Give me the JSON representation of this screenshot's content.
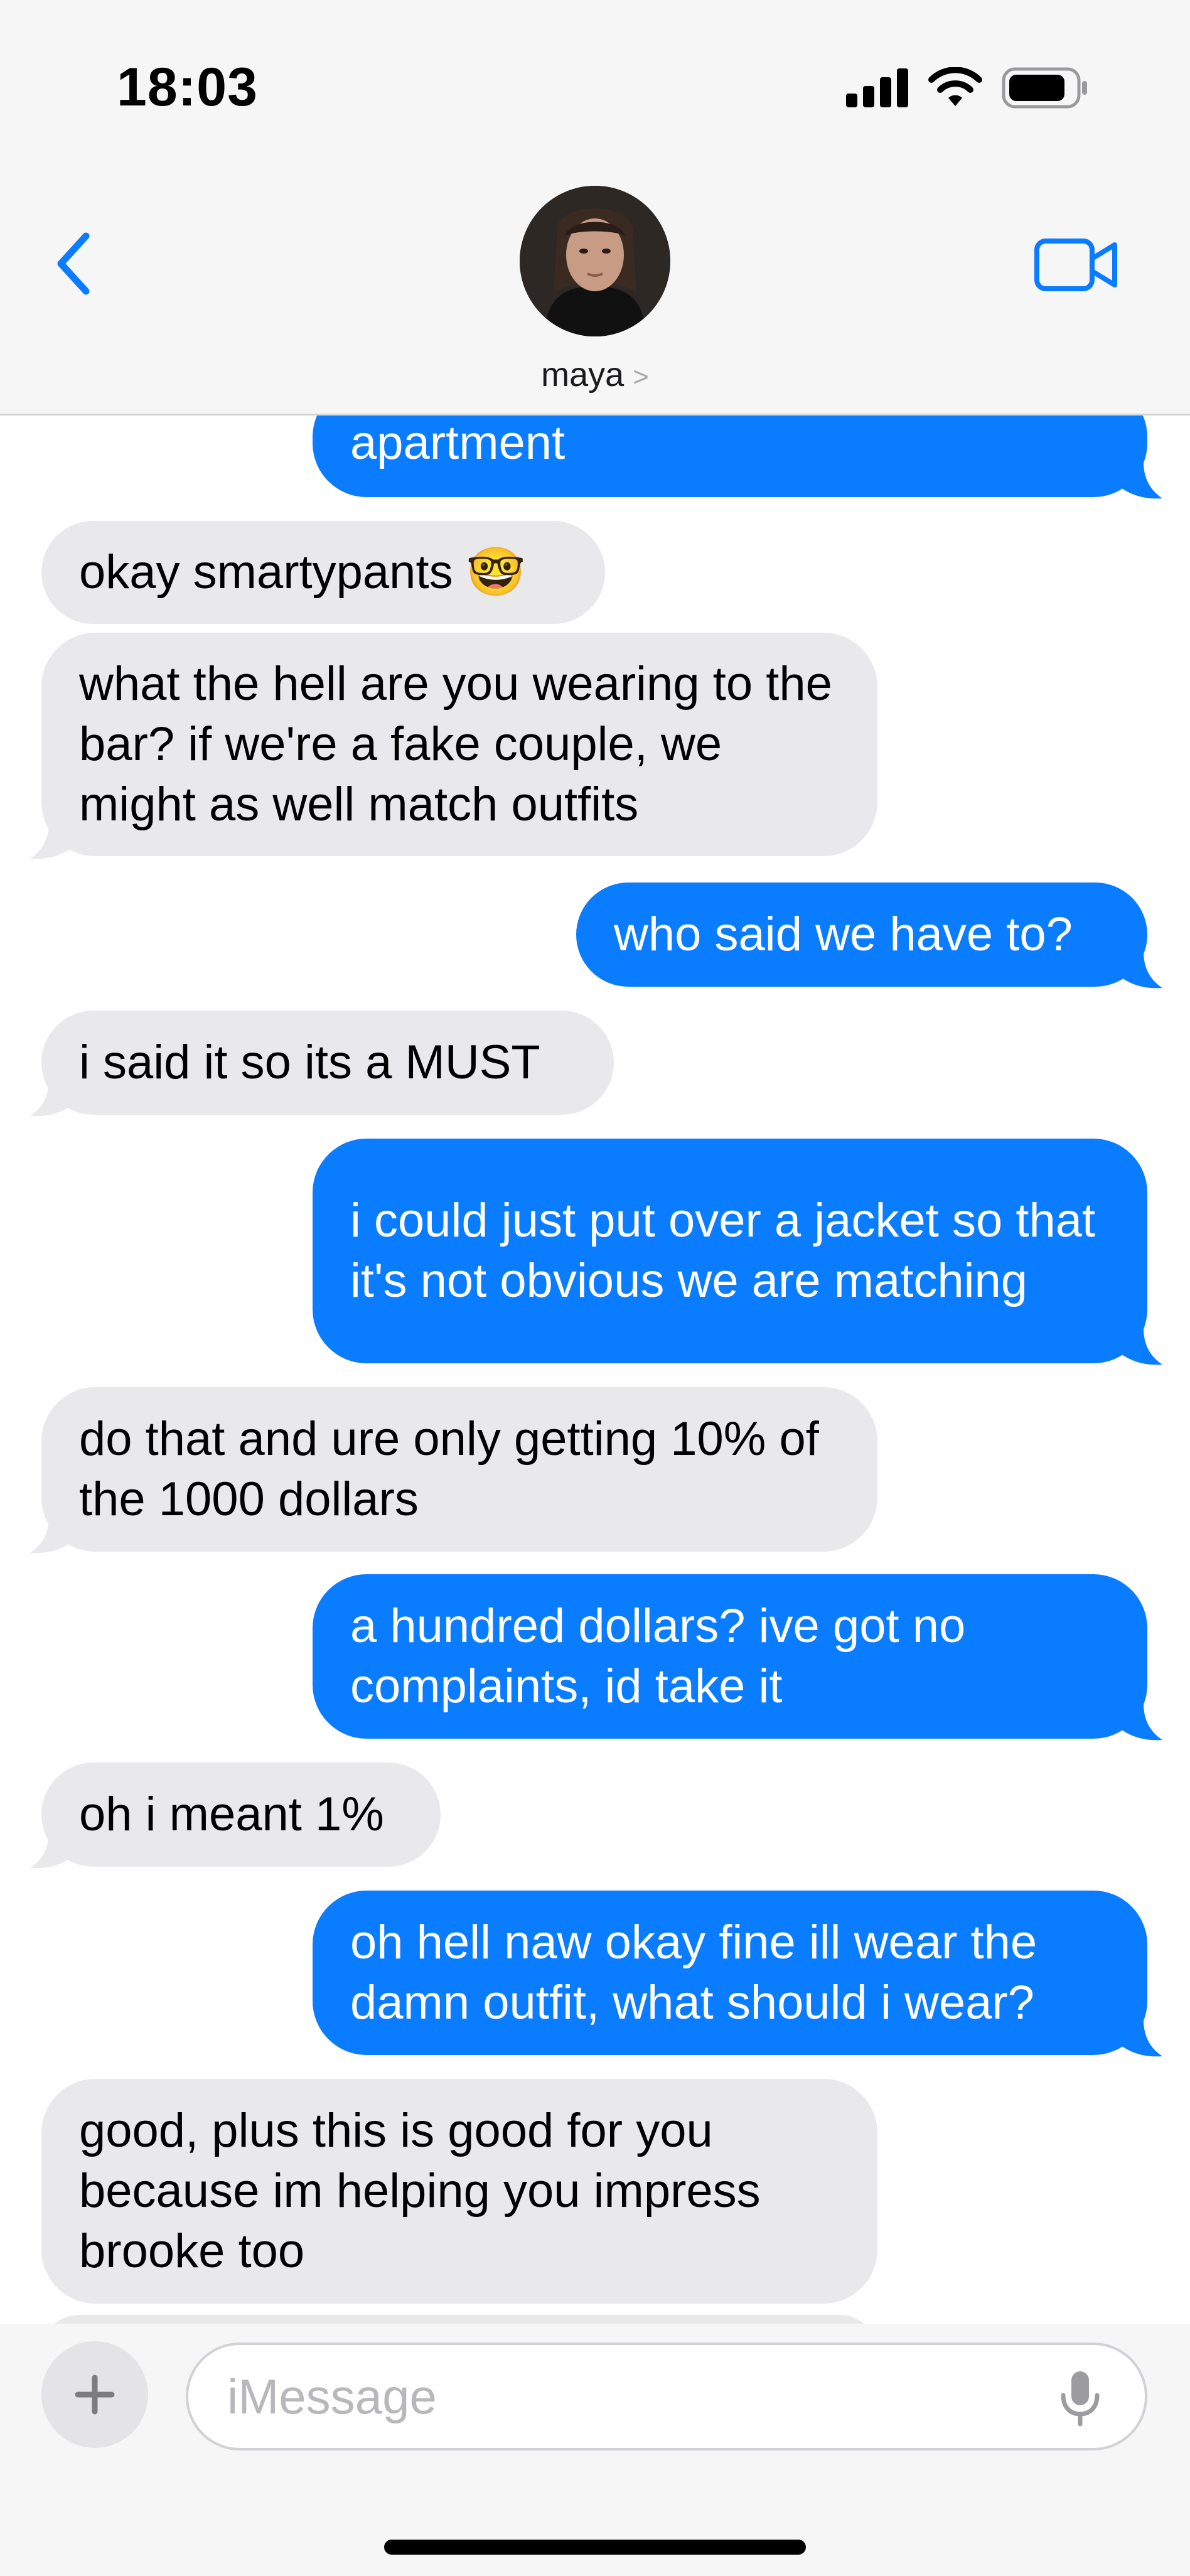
{
  "status_bar": {
    "time": "18:03",
    "icons": [
      "cellular-signal-icon",
      "wifi-icon",
      "battery-icon"
    ]
  },
  "header": {
    "back_icon": "chevron-left-icon",
    "contact_name": "maya",
    "contact_chevron": ">",
    "video_icon": "video-camera-icon"
  },
  "messages": [
    {
      "from": "me",
      "text": "apartment"
    },
    {
      "from": "them",
      "text": "okay smartypants 🤓"
    },
    {
      "from": "them",
      "text": "what the hell are you wearing to the bar? if we're a fake couple, we might as well match outfits"
    },
    {
      "from": "me",
      "text": "who said we have to?"
    },
    {
      "from": "them",
      "text": "i said it so its a MUST"
    },
    {
      "from": "me",
      "text": "i could just put over a jacket so that it's not obvious we are matching"
    },
    {
      "from": "them",
      "text": "do that and ure only getting 10% of the 1000 dollars"
    },
    {
      "from": "me",
      "text": "a hundred dollars? ive got no complaints, id take it"
    },
    {
      "from": "them",
      "text": "oh i meant 1%"
    },
    {
      "from": "me",
      "text": "oh hell naw okay fine ill wear the damn outfit, what should i wear?"
    },
    {
      "from": "them",
      "text": "good, plus this is good for you because im helping you impress brooke too"
    }
  ],
  "composer": {
    "add_icon": "plus-icon",
    "placeholder": "iMessage",
    "mic_icon": "microphone-icon"
  },
  "colors": {
    "sent_bubble": "#0a7cff",
    "received_bubble": "#e9e9eb",
    "accent": "#0a7cff",
    "header_bg": "#f6f6f6"
  }
}
